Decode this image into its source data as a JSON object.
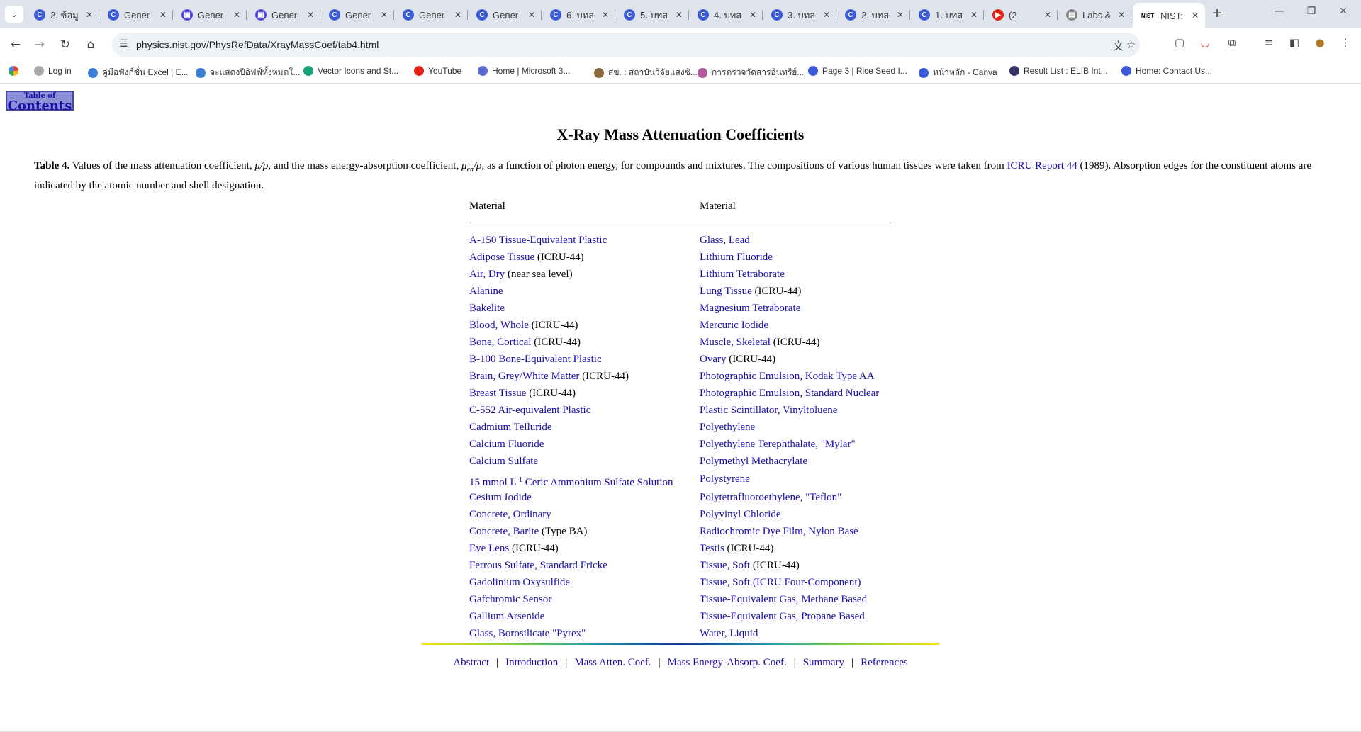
{
  "browser": {
    "tabs": [
      {
        "title": "2. ข้อมู",
        "fav": "C",
        "color": "#3b5bdb"
      },
      {
        "title": "Gener",
        "fav": "C",
        "color": "#3b5bdb"
      },
      {
        "title": "Gener",
        "fav": "▣",
        "color": "#5b4bdb"
      },
      {
        "title": "Gener",
        "fav": "▣",
        "color": "#5b4bdb"
      },
      {
        "title": "Gener",
        "fav": "C",
        "color": "#3b5bdb"
      },
      {
        "title": "Gener",
        "fav": "C",
        "color": "#3b5bdb"
      },
      {
        "title": "Gener",
        "fav": "C",
        "color": "#3b5bdb"
      },
      {
        "title": "6. บทส",
        "fav": "C",
        "color": "#3b5bdb"
      },
      {
        "title": "5. บทส",
        "fav": "C",
        "color": "#3b5bdb"
      },
      {
        "title": "4. บทส",
        "fav": "C",
        "color": "#3b5bdb"
      },
      {
        "title": "3. บทส",
        "fav": "C",
        "color": "#3b5bdb"
      },
      {
        "title": "2. บทส",
        "fav": "C",
        "color": "#3b5bdb"
      },
      {
        "title": "1. บทส",
        "fav": "C",
        "color": "#3b5bdb"
      },
      {
        "title": "(2",
        "fav": "▶",
        "color": "#e62117"
      },
      {
        "title": "Labs &",
        "fav": "▤",
        "color": "#888888"
      },
      {
        "title": "NIST:",
        "fav": "NIST",
        "color": "#ffffff"
      }
    ],
    "url": "physics.nist.gov/PhysRefData/XrayMassCoef/tab4.html",
    "bookmarks": [
      {
        "label": "Log in",
        "color": "#aaaaaa"
      },
      {
        "label": "คู่มือฟังก์ชั่น Excel | E...",
        "color": "#3b7fd4"
      },
      {
        "label": "จะแสดงปีอิฟฟ์ทั้งหมดใ...",
        "color": "#3b7fd4"
      },
      {
        "label": "Vector Icons and St...",
        "color": "#1aa37a"
      },
      {
        "label": "YouTube",
        "color": "#e62117"
      },
      {
        "label": "Home | Microsoft 3...",
        "color": "#5b6bd4"
      },
      {
        "label": "สข. : สถาบันวิจัยแสงซิ...",
        "color": "#8a6a3a"
      },
      {
        "label": "การตรวจวัดสารอินทรีย์...",
        "color": "#b05a9a"
      },
      {
        "label": "Page 3 | Rice Seed I...",
        "color": "#3b5bdb"
      },
      {
        "label": "หน้าหลัก - Canva",
        "color": "#3b5bdb"
      },
      {
        "label": "Result List : ELIB Int...",
        "color": "#333366"
      },
      {
        "label": "Home: Contact Us...",
        "color": "#3b5bdb"
      }
    ]
  },
  "page": {
    "toc_line1": "Table of",
    "toc_line2": "Contents",
    "title": "X-Ray Mass Attenuation Coefficients",
    "caption": {
      "label": "Table 4.",
      "part1": " Values of the mass attenuation coefficient, ",
      "mu_rho": "μ/ρ",
      "part2": ", and the mass energy-absorption coefficient, ",
      "mu_en": "μ",
      "en_sub": "en",
      "rho": "/ρ",
      "part3": ", as a function of photon energy, for compounds and mixtures. The compositions of various human tissues were taken from ",
      "link": "ICRU Report 44",
      "part4": " (1989). Absorption edges for the constituent atoms are indicated by the atomic number and shell designation."
    },
    "col_header_left": "Material",
    "col_header_right": "Material",
    "left_materials": [
      {
        "link": "A-150 Tissue-Equivalent Plastic",
        "note": ""
      },
      {
        "link": "Adipose Tissue",
        "note": " (ICRU-44)"
      },
      {
        "link": "Air, Dry",
        "note": " (near sea level)"
      },
      {
        "link": "Alanine",
        "note": ""
      },
      {
        "link": "Bakelite",
        "note": ""
      },
      {
        "link": "Blood, Whole",
        "note": " (ICRU-44)"
      },
      {
        "link": "Bone, Cortical",
        "note": " (ICRU-44)"
      },
      {
        "link": "B-100 Bone-Equivalent Plastic",
        "note": ""
      },
      {
        "link": "Brain, Grey/White Matter",
        "note": " (ICRU-44)"
      },
      {
        "link": "Breast Tissue",
        "note": " (ICRU-44)"
      },
      {
        "link": "C-552 Air-equivalent Plastic",
        "note": ""
      },
      {
        "link": "Cadmium Telluride",
        "note": ""
      },
      {
        "link": "Calcium Fluoride",
        "note": ""
      },
      {
        "link": "Calcium Sulfate",
        "note": ""
      },
      {
        "link": "15 mmol L",
        "sup": "-1",
        "link2": " Ceric Ammonium Sulfate Solution",
        "note": ""
      },
      {
        "link": "Cesium Iodide",
        "note": ""
      },
      {
        "link": "Concrete, Ordinary",
        "note": ""
      },
      {
        "link": "Concrete, Barite",
        "note": " (Type BA)"
      },
      {
        "link": "Eye Lens",
        "note": " (ICRU-44)"
      },
      {
        "link": "Ferrous Sulfate, Standard Fricke",
        "note": ""
      },
      {
        "link": "Gadolinium Oxysulfide",
        "note": ""
      },
      {
        "link": "Gafchromic Sensor",
        "note": ""
      },
      {
        "link": "Gallium Arsenide",
        "note": ""
      },
      {
        "link": "Glass, Borosilicate \"Pyrex\"",
        "note": ""
      }
    ],
    "right_materials": [
      {
        "link": "Glass, Lead",
        "note": ""
      },
      {
        "link": "Lithium Fluoride",
        "note": ""
      },
      {
        "link": "Lithium Tetraborate",
        "note": ""
      },
      {
        "link": "Lung Tissue",
        "note": " (ICRU-44)"
      },
      {
        "link": "Magnesium Tetraborate",
        "note": ""
      },
      {
        "link": "Mercuric Iodide",
        "note": ""
      },
      {
        "link": "Muscle, Skeletal",
        "note": " (ICRU-44)"
      },
      {
        "link": "Ovary",
        "note": " (ICRU-44)"
      },
      {
        "link": "Photographic Emulsion, Kodak Type AA",
        "note": ""
      },
      {
        "link": "Photographic Emulsion, Standard Nuclear",
        "note": ""
      },
      {
        "link": "Plastic Scintillator, Vinyltoluene",
        "note": ""
      },
      {
        "link": "Polyethylene",
        "note": ""
      },
      {
        "link": "Polyethylene Terephthalate, \"Mylar\"",
        "note": ""
      },
      {
        "link": "Polymethyl Methacrylate",
        "note": ""
      },
      {
        "link": "Polystyrene",
        "note": ""
      },
      {
        "link": "Polytetrafluoroethylene, \"Teflon\"",
        "note": ""
      },
      {
        "link": "Polyvinyl Chloride",
        "note": ""
      },
      {
        "link": "Radiochromic Dye Film, Nylon Base",
        "note": ""
      },
      {
        "link": "Testis",
        "note": " (ICRU-44)"
      },
      {
        "link": "Tissue, Soft",
        "note": " (ICRU-44)"
      },
      {
        "link": "Tissue, Soft (ICRU Four-Component)",
        "note": ""
      },
      {
        "link": "Tissue-Equivalent Gas, Methane Based",
        "note": ""
      },
      {
        "link": "Tissue-Equivalent Gas, Propane Based",
        "note": ""
      },
      {
        "link": "Water, Liquid",
        "note": ""
      }
    ],
    "footer_links": [
      "Abstract",
      "Introduction",
      "Mass Atten. Coef.",
      "Mass Energy-Absorp. Coef.",
      "Summary",
      "References"
    ],
    "footer_separator": "|"
  }
}
